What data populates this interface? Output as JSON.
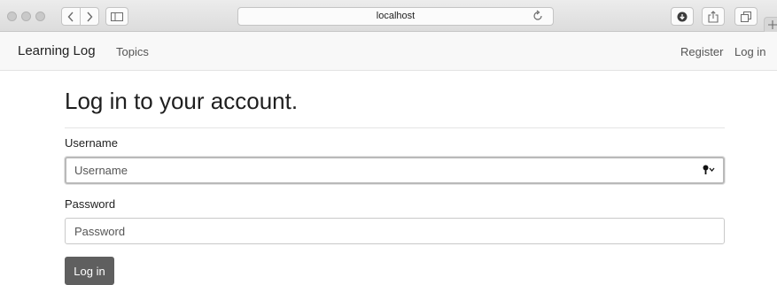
{
  "browser": {
    "address": "localhost"
  },
  "navbar": {
    "brand": "Learning Log",
    "topics": "Topics",
    "register": "Register",
    "login": "Log in"
  },
  "page": {
    "heading": "Log in to your account."
  },
  "form": {
    "username_label": "Username",
    "username_placeholder": "Username",
    "password_label": "Password",
    "password_placeholder": "Password",
    "submit_label": "Log in"
  }
}
